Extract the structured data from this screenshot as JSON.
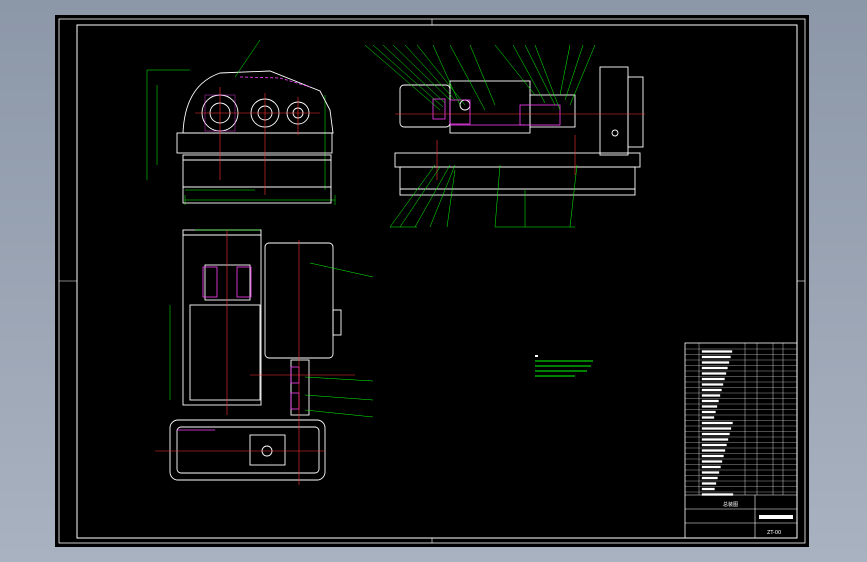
{
  "colors": {
    "background": "#000000",
    "outline": "#ffffff",
    "centerline": "#ff3030",
    "dimension": "#00ff00",
    "hatch": "#ff40ff",
    "leader": "#00ff00"
  },
  "title_block": {
    "drawing_title": "总装图",
    "drawing_code": "ZT-00"
  }
}
